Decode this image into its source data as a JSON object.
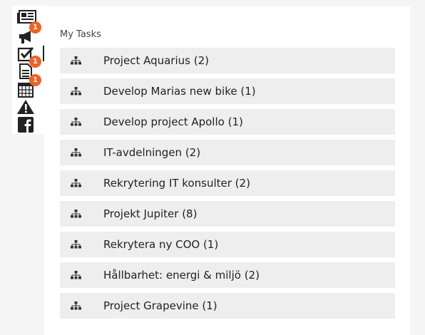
{
  "sidebar": {
    "items": [
      {
        "name": "news-icon",
        "badge": ""
      },
      {
        "name": "megaphone-icon",
        "badge": "1"
      },
      {
        "name": "tasks-checkbox-icon",
        "badge": ""
      },
      {
        "name": "document-icon",
        "badge": "1"
      },
      {
        "name": "calendar-icon",
        "badge": "1"
      },
      {
        "name": "warning-icon",
        "badge": ""
      },
      {
        "name": "facebook-icon",
        "badge": ""
      }
    ]
  },
  "main": {
    "title": "My Tasks",
    "tasks": [
      {
        "label": "Project Aquarius (2)"
      },
      {
        "label": "Develop Marias new bike (1)"
      },
      {
        "label": "Develop project Apollo (1)"
      },
      {
        "label": "IT-avdelningen (2)"
      },
      {
        "label": "Rekrytering IT konsulter (2)"
      },
      {
        "label": "Projekt Jupiter (8)"
      },
      {
        "label": "Rekrytera ny COO (1)"
      },
      {
        "label": "Hållbarhet: energi & miljö (2)"
      },
      {
        "label": "Project Grapevine (1)"
      }
    ],
    "task_icon": "hierarchy-icon"
  },
  "colors": {
    "badge": "#f06223",
    "row_bg": "#eeeeee"
  }
}
